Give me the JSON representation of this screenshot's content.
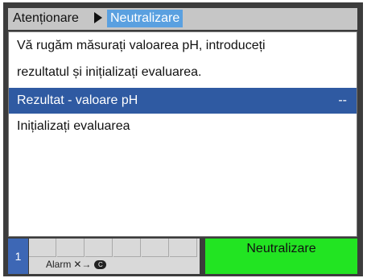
{
  "breadcrumb": {
    "root": "Atenționare",
    "current": "Neutralizare"
  },
  "message": {
    "line1": "Vă rugăm măsurați valoarea pH, introduceți",
    "line2": "rezultatul și inițializați evaluarea."
  },
  "menu": {
    "result_label": "Rezultat - valoare pH",
    "result_value": "--",
    "init_label": "Inițializați evaluarea"
  },
  "footer": {
    "page_number": "1",
    "softkey_text": "Alarm",
    "softkey_arrow": "✕→",
    "softkey_c": "C",
    "action_label": "Neutralizare"
  },
  "colors": {
    "selection": "#2f5aa2",
    "breadcrumb_highlight": "#5aa0e0",
    "action_green": "#22e422",
    "page_badge": "#3d67b5"
  }
}
